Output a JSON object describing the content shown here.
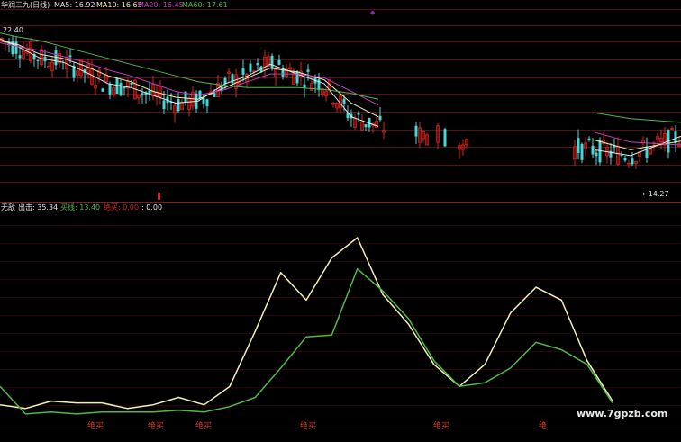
{
  "colors": {
    "background": "#000000",
    "white": "#e6e6e6",
    "yellow": "#f3f0b4",
    "purple": "#c23cc0",
    "green": "#52b848",
    "red": "#d2241e",
    "cyan": "#49d6d6",
    "grid_red": "#5a0f12"
  },
  "price_header": {
    "title": "华润三九(日线)",
    "ma5": "MA5: 16.92",
    "ma10": "MA10: 16.65",
    "ma20": "MA20: 16.45",
    "ma60": "MA60: 17.61"
  },
  "price_labels": {
    "high": "22.40",
    "low": "←14.27"
  },
  "indicator_header": {
    "name": "无敌",
    "out": "出击: 35.34",
    "buy_line": "买线: 13.40",
    "absolute_buy": "绝买: 0.00",
    "extra": ": 0.00"
  },
  "bottom_marks": [
    "绝买",
    "绝买",
    "绝买",
    "绝买",
    "绝买",
    "绝"
  ],
  "watermark": "www.7gpzb.com",
  "chart_data": [
    {
      "type": "line",
      "title": "华润三九(日线)",
      "series": [
        {
          "name": "MA5",
          "values": [
            21.9,
            21.5,
            20.9,
            20.7,
            20.2,
            19.6,
            19.4,
            19.0,
            18.6,
            18.7,
            19.6,
            20.0,
            20.6,
            20.1,
            19.6,
            17.9,
            17.4,
            17.0,
            16.2,
            15.9,
            16.9
          ]
        },
        {
          "name": "MA10",
          "values": [
            21.8,
            21.6,
            21.1,
            20.9,
            20.5,
            20.0,
            19.7,
            19.2,
            18.9,
            18.8,
            19.4,
            19.9,
            20.4,
            20.2,
            19.8,
            18.6,
            17.9,
            17.4,
            16.7,
            16.2,
            16.65
          ]
        },
        {
          "name": "MA20",
          "values": [
            21.7,
            21.5,
            21.3,
            21.0,
            20.7,
            20.3,
            20.0,
            19.6,
            19.2,
            19.0,
            19.3,
            19.7,
            20.1,
            20.1,
            19.9,
            19.2,
            18.5,
            17.8,
            17.1,
            16.6,
            16.45
          ]
        },
        {
          "name": "MA60",
          "values": [
            22.2,
            22.0,
            21.8,
            21.5,
            21.2,
            20.9,
            20.6,
            20.3,
            20.0,
            19.7,
            19.5,
            19.4,
            19.4,
            19.4,
            19.3,
            19.1,
            18.8,
            18.5,
            18.1,
            17.8,
            17.61
          ]
        }
      ],
      "annotations": [
        "22.40",
        "14.27"
      ],
      "ylim": [
        14.0,
        22.6
      ]
    },
    {
      "type": "line",
      "title": "无敌",
      "series": [
        {
          "name": "出击",
          "values": [
            8,
            6,
            10,
            9,
            9,
            6,
            8,
            12,
            8,
            18,
            48,
            80,
            65,
            88,
            99,
            68,
            52,
            30,
            18,
            30,
            58,
            72,
            65,
            32,
            10
          ]
        },
        {
          "name": "买线",
          "values": [
            18,
            3,
            4,
            3,
            4,
            4,
            4,
            5,
            4,
            7,
            12,
            28,
            45,
            46,
            82,
            70,
            55,
            32,
            18,
            20,
            28,
            42,
            38,
            30,
            9
          ]
        }
      ],
      "ylim": [
        0,
        100
      ]
    }
  ]
}
